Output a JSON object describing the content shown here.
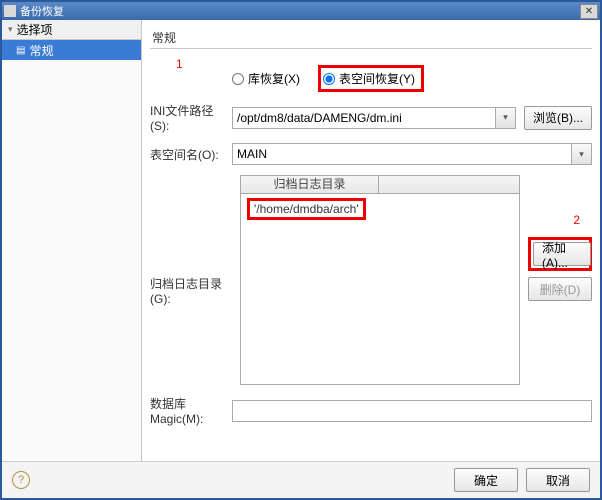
{
  "titlebar": {
    "title": "备份恢复"
  },
  "sidebar": {
    "heading": "选择项",
    "items": [
      {
        "label": "常规"
      }
    ]
  },
  "tab": {
    "label": "常规"
  },
  "annotations": {
    "n1": "1",
    "n2": "2"
  },
  "radios": {
    "db_restore": "库恢复(X)",
    "ts_restore": "表空间恢复(Y)",
    "selected": "ts_restore"
  },
  "iniRow": {
    "label": "INI文件路径(S):",
    "value": "/opt/dm8/data/DAMENG/dm.ini",
    "browse": "浏览(B)..."
  },
  "tsRow": {
    "label": "表空间名(O):",
    "value": "MAIN"
  },
  "archRow": {
    "label": "归档日志目录(G):",
    "column_header": "归档日志目录",
    "items": [
      "'/home/dmdba/arch'"
    ],
    "add": "添加(A)...",
    "del": "删除(D)"
  },
  "magicRow": {
    "label": "数据库Magic(M):",
    "value": ""
  },
  "footer": {
    "ok": "确定",
    "cancel": "取消"
  }
}
